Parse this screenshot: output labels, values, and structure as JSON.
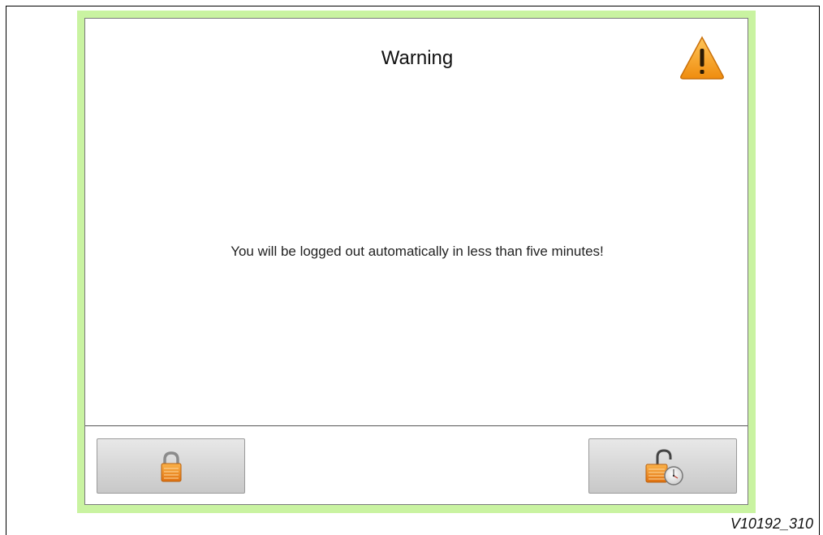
{
  "dialog": {
    "title": "Warning",
    "message": "You will be logged out automatically in less than five minutes!",
    "icons": {
      "title_icon": "warning-triangle-icon",
      "lock_button_icon": "padlock-closed-icon",
      "extend_button_icon": "padlock-open-timer-icon"
    }
  },
  "figure": {
    "id": "V10192_310"
  },
  "colors": {
    "bezel": "#c9f3a1",
    "warning_orange": "#f5a21b",
    "lock_orange": "#f08a1c"
  }
}
